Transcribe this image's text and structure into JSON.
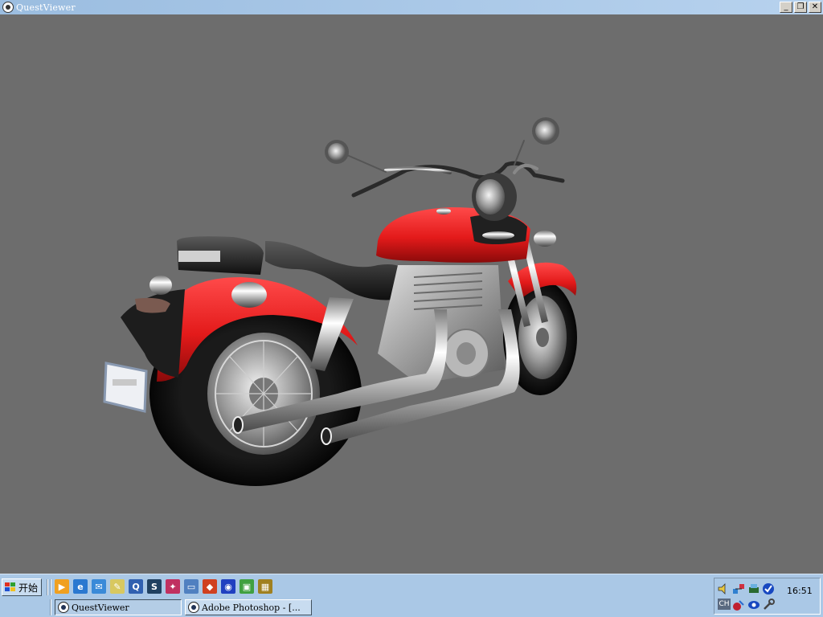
{
  "window": {
    "title": "QuestViewer",
    "minimize_label": "_",
    "restore_label": "❐",
    "close_label": "✕"
  },
  "taskbar": {
    "start_label": "开始",
    "quick_launch": [
      {
        "name": "media-player-icon",
        "color": "#f0a020",
        "glyph": "▶"
      },
      {
        "name": "internet-explorer-icon",
        "color": "#2a78d0",
        "glyph": "e"
      },
      {
        "name": "outlook-express-icon",
        "color": "#3a8ad8",
        "glyph": "✉"
      },
      {
        "name": "notepad-icon",
        "color": "#d8c860",
        "glyph": "✎"
      },
      {
        "name": "quicktime-icon",
        "color": "#3060b0",
        "glyph": "Q"
      },
      {
        "name": "app-s-icon",
        "color": "#204060",
        "glyph": "S"
      },
      {
        "name": "network-icon",
        "color": "#c03060",
        "glyph": "✦"
      },
      {
        "name": "computer-icon",
        "color": "#5080c0",
        "glyph": "▭"
      },
      {
        "name": "gallery-icon",
        "color": "#d04020",
        "glyph": "◆"
      },
      {
        "name": "eye-icon",
        "color": "#2040c0",
        "glyph": "◉"
      },
      {
        "name": "media-icon",
        "color": "#40a040",
        "glyph": "▣"
      },
      {
        "name": "grid-icon",
        "color": "#a08020",
        "glyph": "▦"
      }
    ],
    "tasks": [
      {
        "label": "QuestViewer",
        "active": true
      },
      {
        "label": "Adobe Photoshop - [...",
        "active": false
      }
    ],
    "tray": {
      "clock": "16:51",
      "ime_label": "CH"
    }
  }
}
